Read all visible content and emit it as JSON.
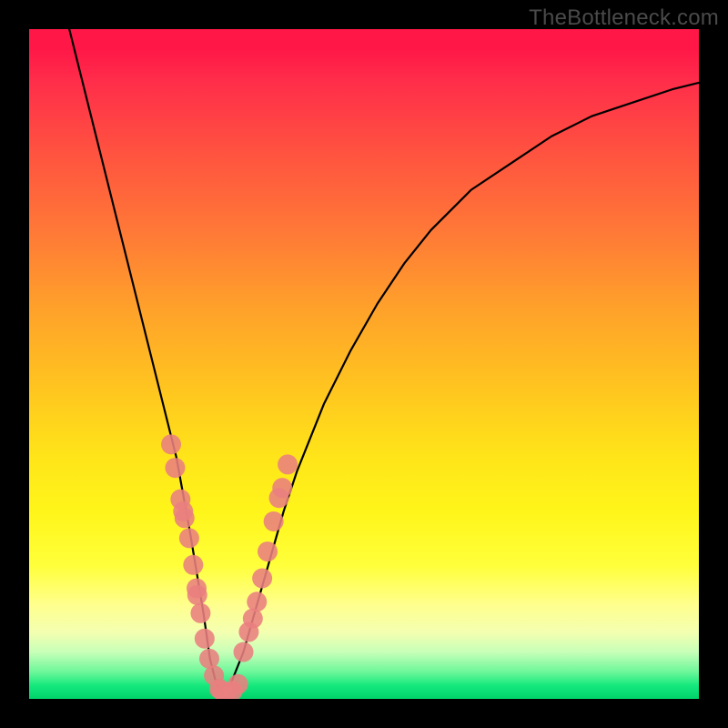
{
  "watermark": "TheBottleneck.com",
  "chart_data": {
    "type": "line",
    "title": "",
    "xlabel": "",
    "ylabel": "",
    "xlim": [
      0,
      100
    ],
    "ylim": [
      0,
      100
    ],
    "grid": false,
    "series": [
      {
        "name": "curve",
        "x": [
          6,
          8,
          10,
          12,
          14,
          16,
          18,
          20,
          22,
          24,
          25,
          26,
          27,
          28,
          30,
          32,
          34,
          36,
          38,
          40,
          44,
          48,
          52,
          56,
          60,
          66,
          72,
          78,
          84,
          90,
          96,
          100
        ],
        "y": [
          100,
          92,
          84,
          76,
          68,
          60,
          52,
          44,
          36,
          25,
          19,
          13,
          6,
          2,
          2,
          7,
          14,
          21,
          28,
          34,
          44,
          52,
          59,
          65,
          70,
          76,
          80,
          84,
          87,
          89,
          91,
          92
        ]
      },
      {
        "name": "left-cluster",
        "x": [
          21.2,
          21.8,
          22.6,
          23.0,
          23.2,
          23.9,
          24.5,
          25.0,
          25.1,
          25.6,
          26.2,
          26.9,
          27.6,
          28.4
        ],
        "y": [
          38.0,
          34.5,
          29.8,
          28.0,
          27.0,
          24.0,
          20.0,
          16.5,
          15.5,
          12.8,
          9.0,
          6.0,
          3.5,
          1.5
        ]
      },
      {
        "name": "right-cluster",
        "x": [
          32.0,
          32.8,
          33.4,
          34.0,
          34.8,
          35.6,
          36.5,
          37.3,
          37.8,
          38.6
        ],
        "y": [
          7.0,
          10.0,
          12.0,
          14.5,
          18.0,
          22.0,
          26.5,
          30.0,
          31.5,
          35.0
        ]
      },
      {
        "name": "bottom-cluster",
        "x": [
          28.8,
          29.6,
          30.4,
          31.2
        ],
        "y": [
          1.2,
          1.0,
          1.2,
          2.2
        ]
      }
    ]
  }
}
